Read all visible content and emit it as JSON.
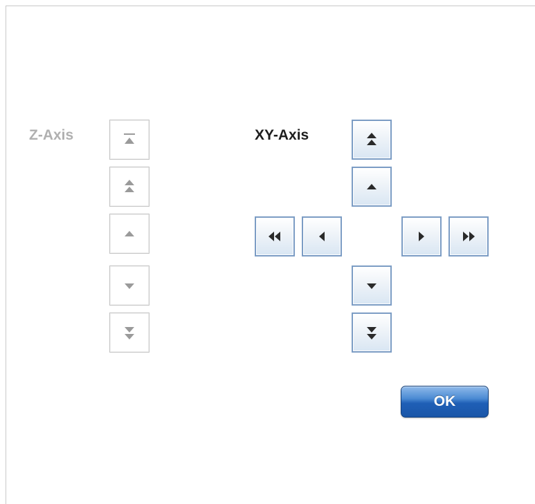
{
  "z_axis": {
    "label": "Z-Axis",
    "enabled": false,
    "buttons": [
      {
        "icon": "z-top-icon"
      },
      {
        "icon": "double-up-icon"
      },
      {
        "icon": "up-icon"
      },
      {
        "icon": "down-icon"
      },
      {
        "icon": "double-down-icon"
      }
    ]
  },
  "xy_axis": {
    "label": "XY-Axis",
    "enabled": true,
    "buttons": [
      {
        "icon": "double-up-icon"
      },
      {
        "icon": "up-icon"
      },
      {
        "icon": "double-left-icon"
      },
      {
        "icon": "left-icon"
      },
      {
        "icon": "right-icon"
      },
      {
        "icon": "double-right-icon"
      },
      {
        "icon": "down-icon"
      },
      {
        "icon": "double-down-icon"
      }
    ]
  },
  "ok_button": {
    "label": "OK"
  },
  "colors": {
    "disabled_glyph": "#9a9a9a",
    "enabled_glyph": "#2a2a2a",
    "active_border": "#7b9cc4",
    "ok_blue": "#1f5fb6"
  }
}
